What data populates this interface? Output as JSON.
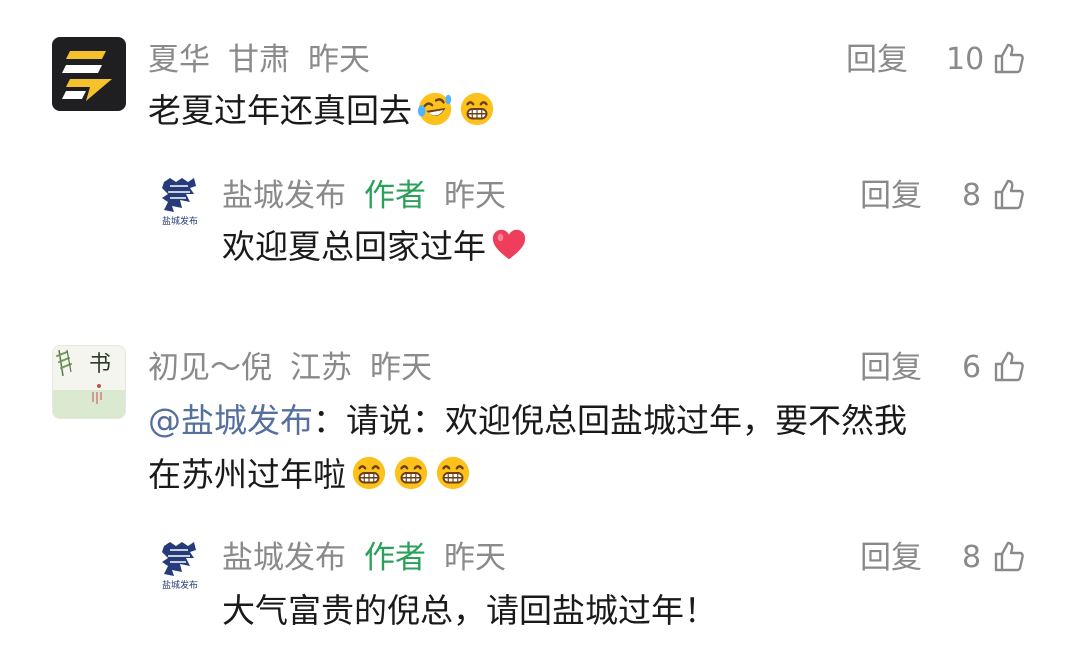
{
  "comments": [
    {
      "user": "夏华",
      "location": "甘肃",
      "time": "昨天",
      "reply_label": "回复",
      "likes": "10",
      "text": "老夏过年还真回去",
      "emojis": [
        "rolling-laughing-emoji",
        "grinning-emoji"
      ]
    },
    {
      "user": "盐城发布",
      "author_badge": "作者",
      "time": "昨天",
      "reply_label": "回复",
      "likes": "8",
      "text": "欢迎夏总回家过年",
      "emojis": [
        "heart-emoji"
      ]
    },
    {
      "user": "初见～倪",
      "location": "江苏",
      "time": "昨天",
      "reply_label": "回复",
      "likes": "6",
      "mention": "@盐城发布",
      "text_line1": "：请说：欢迎倪总回盐城过年，要不然我",
      "text_line2": "在苏州过年啦",
      "emojis": [
        "grinning-emoji",
        "grinning-emoji",
        "grinning-emoji"
      ]
    },
    {
      "user": "盐城发布",
      "author_badge": "作者",
      "time": "昨天",
      "reply_label": "回复",
      "likes": "8",
      "text": "大气富贵的倪总，请回盐城过年！"
    }
  ],
  "avatar_texts": {
    "city_logo_caption": "盐城发布",
    "plant_logo_glyph": "书"
  },
  "icons": {
    "like": "thumbs-up-outline-icon",
    "avatar1": "lightning-logo-icon",
    "avatar2": "yancheng-logo-icon",
    "avatar3": "plant-painting-avatar-icon"
  },
  "colors": {
    "meta_text": "#8a8a8a",
    "author_badge": "#2aa158",
    "mention": "#56709d",
    "content_text": "#1a1a1a"
  }
}
